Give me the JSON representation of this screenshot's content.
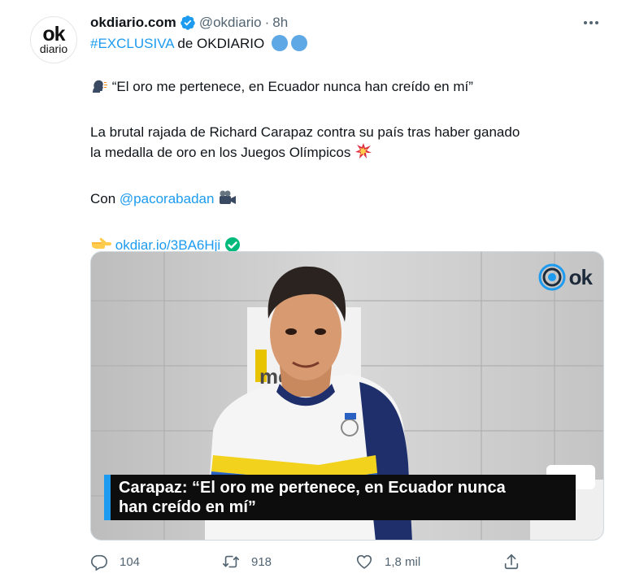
{
  "account": {
    "avatar_top": "ok",
    "avatar_bottom": "diario",
    "name": "okdiario.com",
    "handle": "@okdiario",
    "separator": "·",
    "time": "8h"
  },
  "tweet": {
    "hashtag": "#EXCLUSIVA",
    "line1_rest": "de OKDIARIO",
    "quote": "“El oro me pertenece, en Ecuador nunca han creído en mí”",
    "para_line1": "La brutal rajada de Richard Carapaz contra su país tras haber ganado",
    "para_line2": "la medalla de oro en los Juegos Olímpicos",
    "con_label": "Con",
    "mention": "@pacorabadan",
    "short_link": "okdiar.io/3BA6Hji"
  },
  "media": {
    "watermark": "ok",
    "caption_line1": "Carapaz: “El oro me pertenece, en Ecuador nunca",
    "caption_line2": "han creído en mí”",
    "wall_text": "me"
  },
  "actions": {
    "replies": "104",
    "retweets": "918",
    "likes": "1,8 mil"
  },
  "colors": {
    "link": "#1d9bf0",
    "muted": "#536471",
    "circle": "#5fa8e6",
    "check": "#00ba7c"
  }
}
